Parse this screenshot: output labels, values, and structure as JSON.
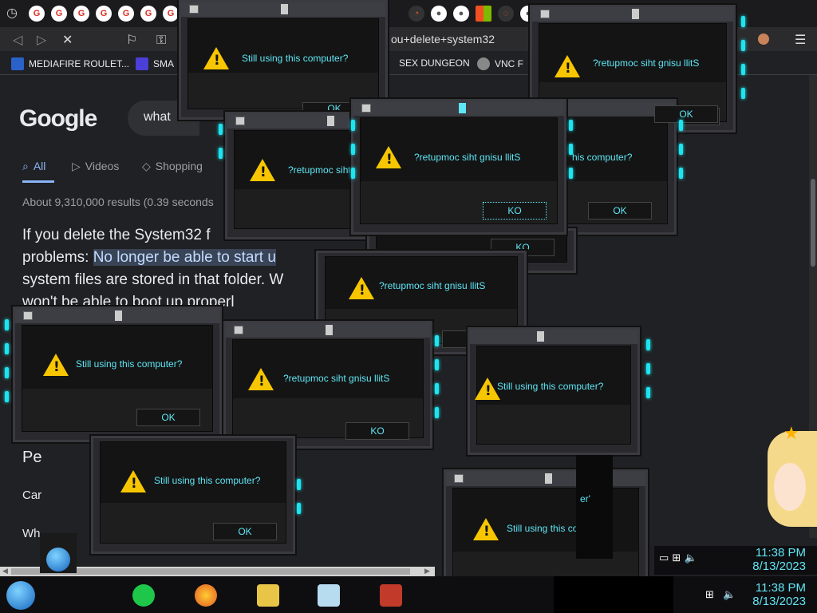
{
  "browser": {
    "url_fragment": "ou+delete+system32",
    "bookmarks": [
      "MEDIAFIRE ROULET...",
      "SMA",
      "SEX DUNGEON",
      "VNC F"
    ]
  },
  "google": {
    "logo": "Google",
    "query": "what",
    "tabs": [
      {
        "label": "All"
      },
      {
        "label": "Videos"
      },
      {
        "label": "Shopping"
      }
    ],
    "stats": "About 9,310,000 results (0.39 seconds",
    "para": [
      "If you delete the System32 f",
      "problems: ",
      "No longer be able to start u",
      "system files are stored in that folder. W",
      "won't be able to boot up properl"
    ],
    "related": [
      "Pe",
      "Car",
      "Car",
      "Wh",
      "Wh"
    ]
  },
  "dialogs": {
    "normal": "Still using this computer?",
    "reversed": "?retupmoc siht gnisu llitS",
    "ok": "OK",
    "ko": "KO",
    "fragment_msg": "his computer?",
    "fragment_msg2": "er'",
    "fragment_msg3": "Still using this co"
  },
  "taskbar": {
    "time": "11:38 PM",
    "date": "8/13/2023",
    "time_ghost": "11:38 PM",
    "date_ghost": "8/13/2023"
  }
}
